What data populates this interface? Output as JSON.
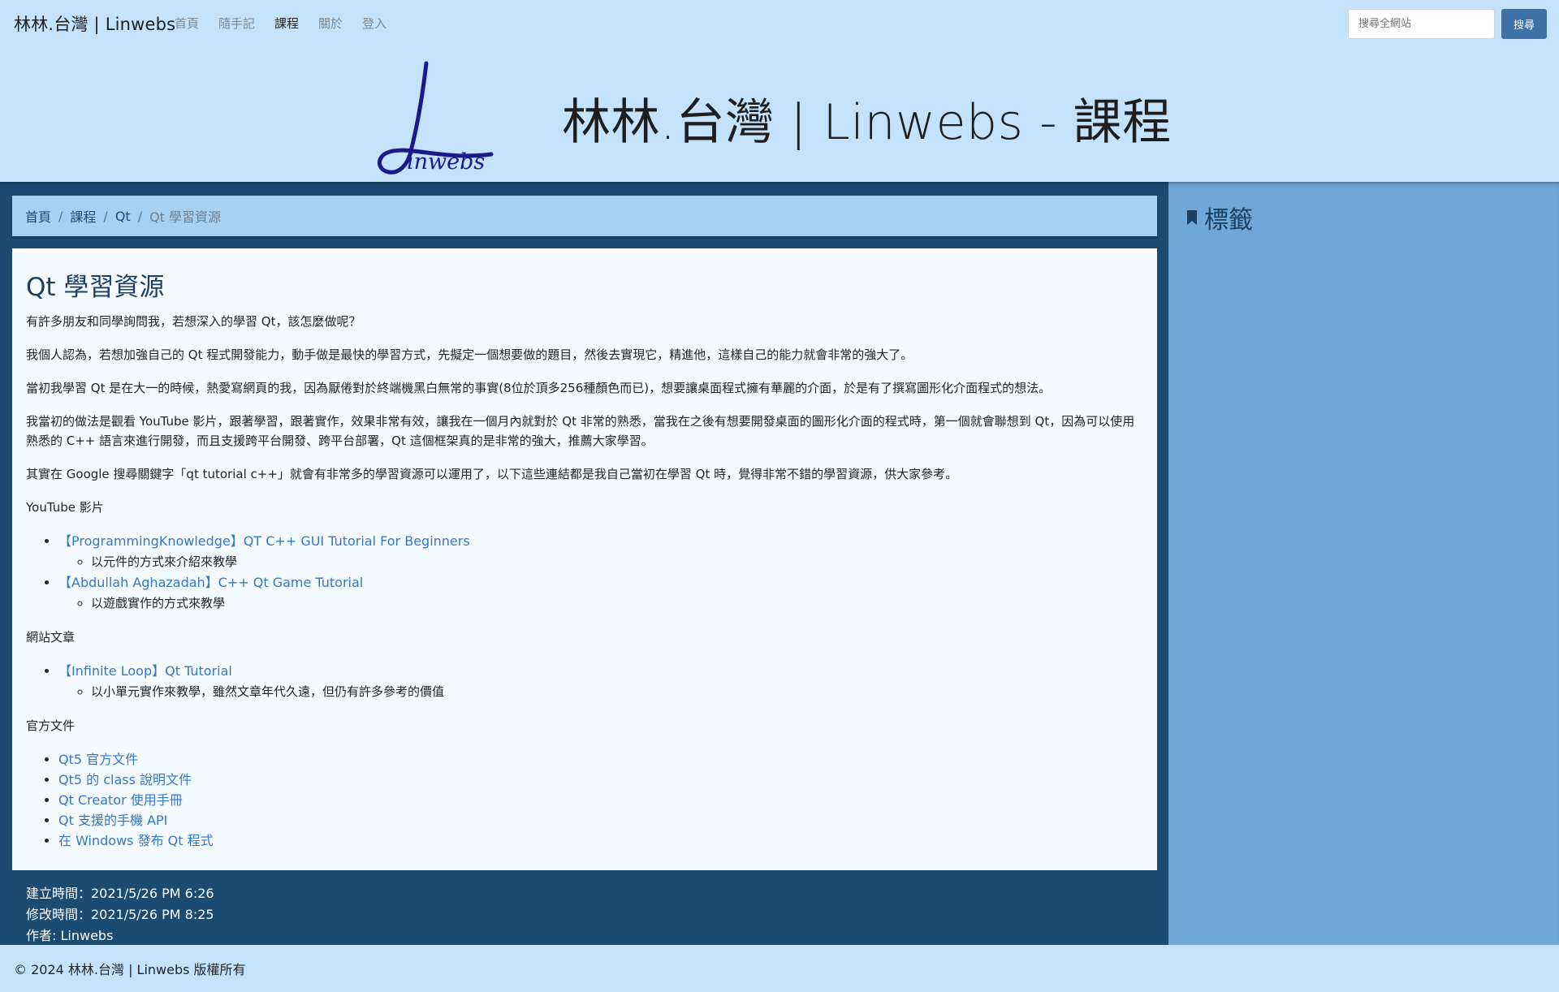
{
  "nav": {
    "brand": "林林.台灣 | Linwebs",
    "links": [
      {
        "label": "首頁",
        "active": false
      },
      {
        "label": "隨手記",
        "active": false
      },
      {
        "label": "課程",
        "active": true
      },
      {
        "label": "關於",
        "active": false
      },
      {
        "label": "登入",
        "active": false
      }
    ],
    "search_placeholder": "搜尋全網站",
    "search_button": "搜尋"
  },
  "banner": {
    "logo_text": "Linwebs",
    "title": "林林.台灣 | Linwebs - 課程"
  },
  "breadcrumb": {
    "items": [
      "首頁",
      "課程",
      "Qt"
    ],
    "separator": "/",
    "current": "Qt 學習資源"
  },
  "article": {
    "title": "Qt 學習資源",
    "paragraphs": [
      "有許多朋友和同學詢問我，若想深入的學習 Qt，該怎麼做呢？",
      "我個人認為，若想加強自己的 Qt 程式開發能力，動手做是最快的學習方式，先擬定一個想要做的題目，然後去實現它，精進他，這樣自己的能力就會非常的強大了。",
      "當初我學習 Qt 是在大一的時候，熱愛寫網頁的我，因為厭倦對於終端機黑白無常的事實(8位於頂多256種顏色而已)，想要讓桌面程式擁有華麗的介面，於是有了撰寫圖形化介面程式的想法。",
      "我當初的做法是觀看 YouTube 影片，跟著學習，跟著實作，效果非常有效，讓我在一個月內就對於 Qt 非常的熟悉，當我在之後有想要開發桌面的圖形化介面的程式時，第一個就會聯想到 Qt，因為可以使用熟悉的 C++ 語言來進行開發，而且支援跨平台開發、跨平台部署，Qt 這個框架真的是非常的強大，推薦大家學習。",
      "其實在 Google 搜尋關鍵字「qt tutorial c++」就會有非常多的學習資源可以運用了，以下這些連結都是我自己當初在學習 Qt 時，覺得非常不錯的學習資源，供大家參考。"
    ],
    "sections": {
      "youtube": {
        "heading": "YouTube 影片",
        "items": [
          {
            "link": "【ProgrammingKnowledge】QT C++ GUI Tutorial For Beginners",
            "note": "以元件的方式來介紹來教學"
          },
          {
            "link": "【Abdullah Aghazadah】C++ Qt Game Tutorial",
            "note": "以遊戲實作的方式來教學"
          }
        ]
      },
      "web": {
        "heading": "網站文章",
        "items": [
          {
            "link": "【Infinite Loop】Qt Tutorial",
            "note": "以小單元實作來教學，雖然文章年代久遠，但仍有許多參考的價值"
          }
        ]
      },
      "official": {
        "heading": "官方文件",
        "links": [
          "Qt5 官方文件",
          "Qt5 的 class 說明文件",
          "Qt Creator 使用手冊",
          "Qt 支援的手機 API",
          "在 Windows 發布 Qt 程式"
        ]
      }
    }
  },
  "meta": {
    "created": "建立時間：2021/5/26 PM 6:26",
    "modified": "修改時間：2021/5/26 PM 8:25",
    "author": "作者: Linwebs"
  },
  "sidebar": {
    "title": "標籤"
  },
  "footer": {
    "copyright": "© 2024 林林.台灣 | Linwebs 版權所有"
  },
  "colors": {
    "page_bg": "#c4e2fb",
    "main_dark": "#1c4b72",
    "sidebar": "#6fa7d9",
    "link": "#3478c6",
    "button": "#3d72a6"
  }
}
